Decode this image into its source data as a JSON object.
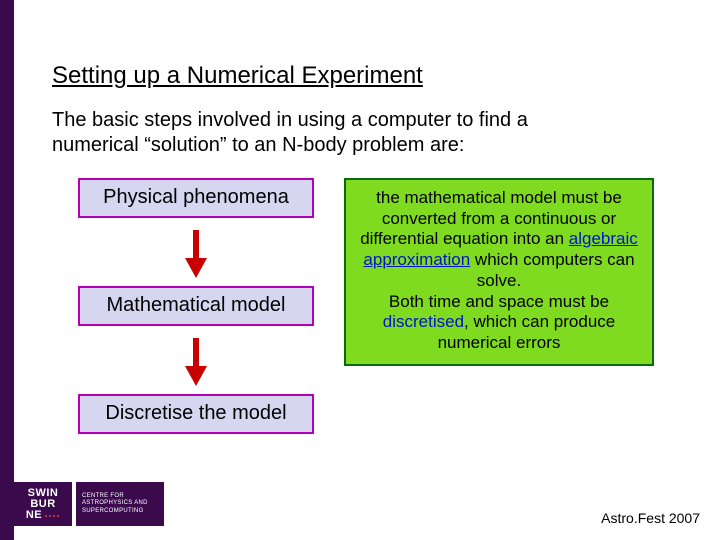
{
  "title": "Setting up a Numerical Experiment",
  "intro": "The basic steps involved in using a computer to find a numerical “solution” to an N-body problem are:",
  "flow": {
    "step1": "Physical phenomena",
    "step2": "Mathematical model",
    "step3": "Discretise the model"
  },
  "info": {
    "t1": "the mathematical model must be converted from a continuous or differential equation into an ",
    "em1": "algebraic approximation",
    "t2": " which computers can solve.",
    "t3": "Both time and space must be ",
    "em2": "discretised",
    "t4": ", which can produce numerical errors"
  },
  "logo": {
    "l1": "SWIN",
    "l2": "BUR",
    "l3": "NE",
    "dept": "Centre for Astrophysics and Supercomputing"
  },
  "footer": "Astro.Fest 2007",
  "colors": {
    "box_border": "#b400b4",
    "box_fill": "#d6d6f0",
    "info_border": "#0a6a0a",
    "info_fill": "#7fdb1f",
    "arrow": "#c80000",
    "brand": "#3a0a4d"
  }
}
